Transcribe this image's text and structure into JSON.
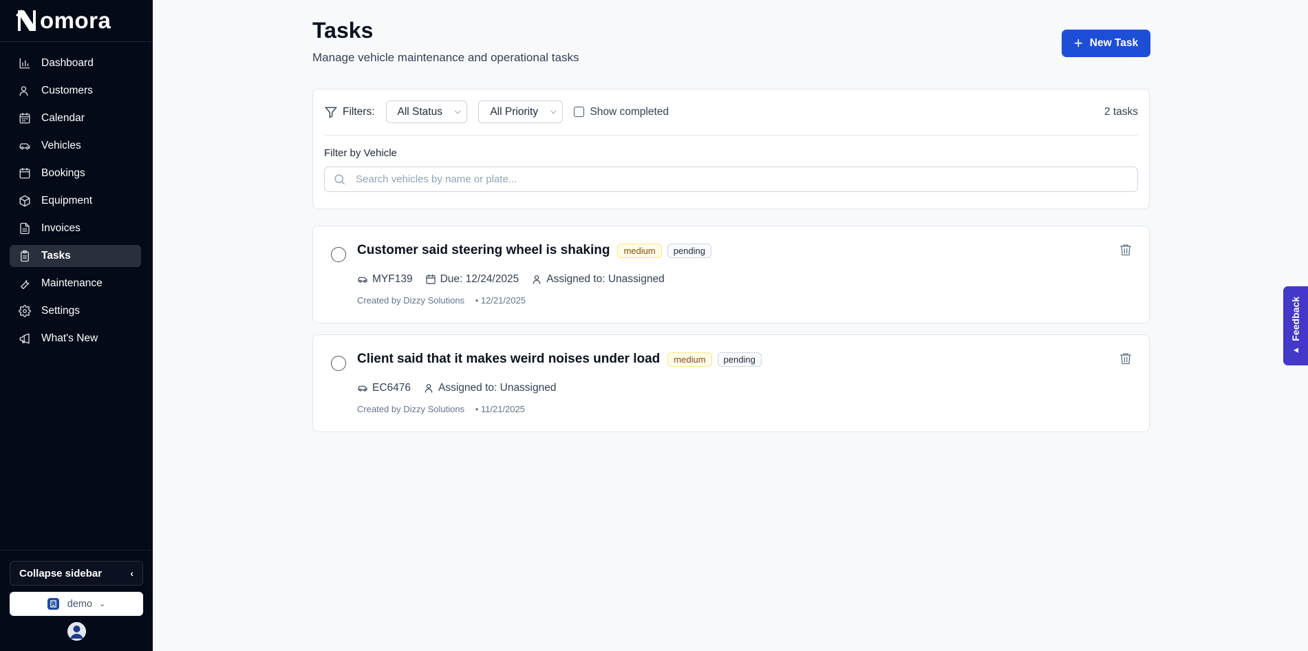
{
  "brand": {
    "name": "omora"
  },
  "sidebar": {
    "items": [
      {
        "label": "Dashboard",
        "icon": "bar-chart-icon"
      },
      {
        "label": "Customers",
        "icon": "user-icon"
      },
      {
        "label": "Calendar",
        "icon": "calendar-grid-icon"
      },
      {
        "label": "Vehicles",
        "icon": "car-icon"
      },
      {
        "label": "Bookings",
        "icon": "calendar-icon"
      },
      {
        "label": "Equipment",
        "icon": "box-icon"
      },
      {
        "label": "Invoices",
        "icon": "file-icon"
      },
      {
        "label": "Tasks",
        "icon": "clipboard-icon",
        "active": true
      },
      {
        "label": "Maintenance",
        "icon": "wrench-icon"
      },
      {
        "label": "Settings",
        "icon": "gear-icon"
      },
      {
        "label": "What's New",
        "icon": "megaphone-icon"
      }
    ],
    "collapse_label": "Collapse sidebar",
    "org_name": "demo"
  },
  "header": {
    "title": "Tasks",
    "subtitle": "Manage vehicle maintenance and operational tasks",
    "new_task_label": "New Task"
  },
  "filters": {
    "label": "Filters:",
    "status_selected": "All Status",
    "priority_selected": "All Priority",
    "show_completed_label": "Show completed",
    "task_count": "2 tasks",
    "vehicle_filter_label": "Filter by Vehicle",
    "vehicle_search_placeholder": "Search vehicles by name or plate..."
  },
  "tasks": [
    {
      "title": "Customer said steering wheel is shaking",
      "priority": "medium",
      "status": "pending",
      "vehicle": "MYF139",
      "due": "Due: 12/24/2025",
      "assigned": "Assigned to: Unassigned",
      "created_by": "Created by Dizzy Solutions",
      "created_date": "• 12/21/2025"
    },
    {
      "title": "Client said that it makes weird noises under load",
      "priority": "medium",
      "status": "pending",
      "vehicle": "EC6476",
      "assigned": "Assigned to: Unassigned",
      "created_by": "Created by Dizzy Solutions",
      "created_date": "• 11/21/2025"
    }
  ],
  "feedback_label": "Feedback",
  "colors": {
    "sidebar_bg": "#050a18",
    "primary": "#1d4ed8",
    "feedback": "#4338ca"
  }
}
